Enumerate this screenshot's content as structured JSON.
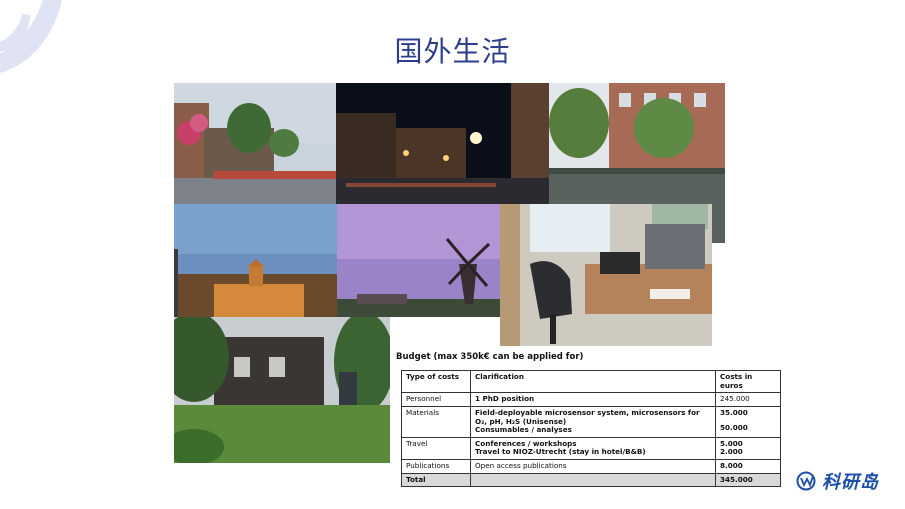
{
  "slide": {
    "title": "国外生活"
  },
  "photos": [
    {
      "name": "canal-street-photo",
      "subject": "canal street with flowers"
    },
    {
      "name": "night-street-photo",
      "subject": "city street at night"
    },
    {
      "name": "canal-houses-photo",
      "subject": "canal with trees and brick houses"
    },
    {
      "name": "royal-palace-photo",
      "subject": "palace at dusk"
    },
    {
      "name": "windmill-photo",
      "subject": "windmill at purple sunset"
    },
    {
      "name": "office-photo",
      "subject": "office desk and chair by window"
    },
    {
      "name": "garden-house-photo",
      "subject": "house in garden with signpost"
    }
  ],
  "budget": {
    "title": "Budget (max 350k€ can be applied for)",
    "headers": [
      "Type of costs",
      "Clarification",
      "Costs in euros"
    ],
    "rows": {
      "personnel": {
        "type": "Personnel",
        "clarification": "1 PhD position",
        "cost": "245.000"
      },
      "materials": {
        "type": "Materials",
        "clarification_1a": "Field-deployable microsensor system, microsensors for",
        "clarification_1b": "O₂, pH, H₂S (Unisense)",
        "clarification_2": "Consumables / analyses",
        "cost_1": "35.000",
        "cost_2": "50.000"
      },
      "travel": {
        "type": "Travel",
        "clarification_1": "Conferences / workshops",
        "clarification_2": "Travel to NIOZ-Utrecht (stay in hotel/B&B)",
        "cost_1": "5.000",
        "cost_2": "2.000"
      },
      "publications": {
        "type": "Publications",
        "clarification": "Open access publications",
        "cost": "8.000"
      },
      "total": {
        "type": "Total",
        "clarification": "",
        "cost": "345.000"
      }
    }
  },
  "brand": {
    "name": "科研岛"
  },
  "colors": {
    "title": "#2d3f8c",
    "brand": "#1d4fa8",
    "corner_logo": "#dfe3f3"
  }
}
